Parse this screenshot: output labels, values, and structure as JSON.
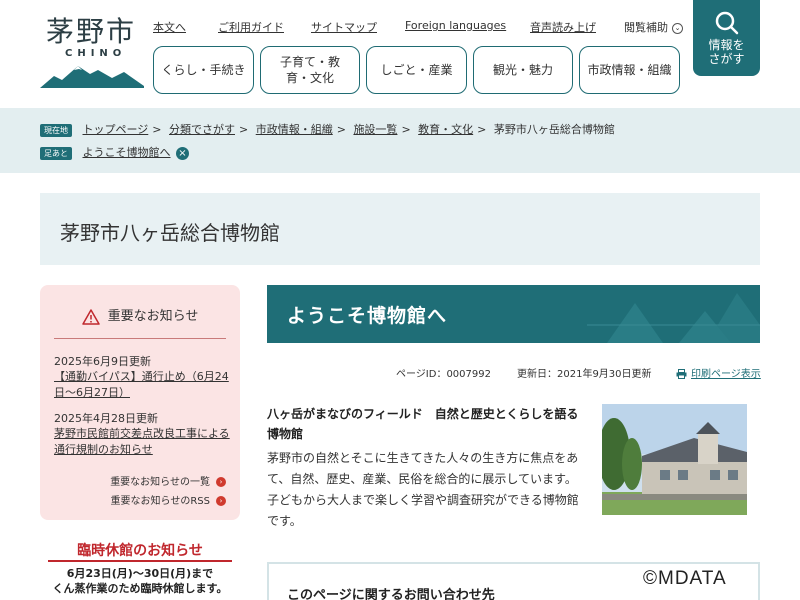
{
  "header": {
    "logo_text": "茅野市",
    "logo_sub": "CHINO",
    "util_links": [
      "本文へ",
      "ご利用ガイド",
      "サイトマップ",
      "Foreign languages",
      "音声読み上げ"
    ],
    "help_label": "閲覧補助",
    "nav": [
      "くらし・手続き",
      "子育て・教育・文化",
      "しごと・産業",
      "観光・魅力",
      "市政情報・組織"
    ],
    "search_label_1": "情報を",
    "search_label_2": "さがす"
  },
  "breadcrumb": {
    "current_tag": "現在地",
    "items": [
      "トップページ",
      "分類でさがす",
      "市政情報・組織",
      "施設一覧",
      "教育・文化"
    ],
    "current": "茅野市八ヶ岳総合博物館",
    "trail_tag": "足あと",
    "trail_item": "ようこそ博物館へ"
  },
  "page_title": "茅野市八ヶ岳総合博物館",
  "notice": {
    "heading": "重要なお知らせ",
    "items": [
      {
        "date": "2025年6月9日更新",
        "text": "【通勤バイパス】通行止め（6月24日～6月27日）"
      },
      {
        "date": "2025年4月28日更新",
        "text": "茅野市民館前交差点改良工事による通行規制のお知らせ"
      }
    ],
    "more_list": "重要なお知らせの一覧",
    "more_rss": "重要なお知らせのRSS"
  },
  "closure": {
    "title": "臨時休館のお知らせ",
    "line1": "6月23日(月)～30日(月)まで",
    "line2": "くん蒸作業のため臨時休館します。"
  },
  "content": {
    "banner_title": "ようこそ博物館へ",
    "page_id": "ページID：0007992",
    "updated": "更新日：2021年9月30日更新",
    "print": "印刷ページ表示",
    "lead": "八ヶ岳がまなびのフィールド　自然と歴史とくらしを語る博物館",
    "body": "茅野市の自然とそこに生きてきた人々の生き方に焦点をあて、自然、歴史、産業、民俗を総合的に展示しています。子どもから大人まで楽しく学習や調査研究ができる博物館です。",
    "contact_title": "このページに関するお問い合わせ先"
  },
  "watermark": "©MDATA",
  "colors": {
    "accent": "#1f6e77",
    "notice_bg": "#fbe4e4",
    "alert_red": "#c0272d"
  }
}
